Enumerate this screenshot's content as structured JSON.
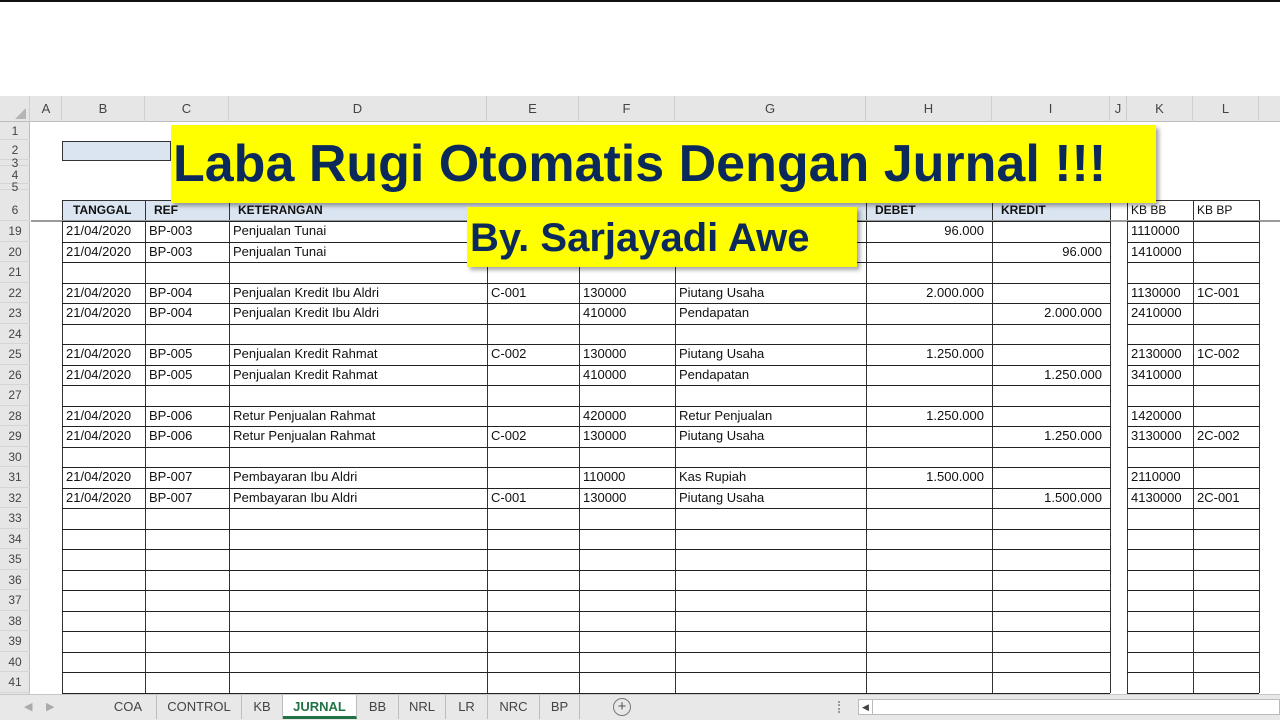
{
  "banner": {
    "title": "Laba Rugi Otomatis Dengan Jurnal !!!",
    "subtitle": "By. Sarjayadi Awe",
    "bg_color": "#ffff00",
    "text_color": "#0b2a5b"
  },
  "columns": [
    "A",
    "B",
    "C",
    "D",
    "E",
    "F",
    "G",
    "H",
    "I",
    "J",
    "K",
    "L"
  ],
  "row_numbers": [
    "1",
    "2",
    "3",
    "4",
    "5",
    "6",
    "19",
    "20",
    "21",
    "22",
    "23",
    "24",
    "25",
    "26",
    "27",
    "28",
    "29",
    "30",
    "31",
    "32",
    "33",
    "34",
    "35",
    "36",
    "37",
    "38",
    "39",
    "40",
    "41"
  ],
  "table_headers": {
    "tanggal": "TANGGAL",
    "ref": "REF",
    "keterangan": "KETERANGAN",
    "debet": "DEBET",
    "kredit": "KREDIT",
    "kb_bb": "KB BB",
    "kb_bp": "KB BP"
  },
  "rows": [
    {
      "row": "19",
      "tanggal": "21/04/2020",
      "ref": "BP-003",
      "keterangan": "Penjualan Tunai",
      "kode": "",
      "akun": "",
      "nama_akun": "",
      "debet": "96.000",
      "kredit": "",
      "kb_bb": "1110000",
      "kb_bp": ""
    },
    {
      "row": "20",
      "tanggal": "21/04/2020",
      "ref": "BP-003",
      "keterangan": "Penjualan Tunai",
      "kode": "",
      "akun": "",
      "nama_akun": "",
      "debet": "",
      "kredit": "96.000",
      "kb_bb": "1410000",
      "kb_bp": ""
    },
    {
      "row": "21",
      "tanggal": "",
      "ref": "",
      "keterangan": "",
      "kode": "",
      "akun": "",
      "nama_akun": "",
      "debet": "",
      "kredit": "",
      "kb_bb": "",
      "kb_bp": ""
    },
    {
      "row": "22",
      "tanggal": "21/04/2020",
      "ref": "BP-004",
      "keterangan": "Penjualan Kredit Ibu Aldri",
      "kode": "C-001",
      "akun": "130000",
      "nama_akun": "Piutang Usaha",
      "debet": "2.000.000",
      "kredit": "",
      "kb_bb": "1130000",
      "kb_bp": "1C-001"
    },
    {
      "row": "23",
      "tanggal": "21/04/2020",
      "ref": "BP-004",
      "keterangan": "Penjualan Kredit Ibu Aldri",
      "kode": "",
      "akun": "410000",
      "nama_akun": "Pendapatan",
      "debet": "",
      "kredit": "2.000.000",
      "kb_bb": "2410000",
      "kb_bp": ""
    },
    {
      "row": "24",
      "tanggal": "",
      "ref": "",
      "keterangan": "",
      "kode": "",
      "akun": "",
      "nama_akun": "",
      "debet": "",
      "kredit": "",
      "kb_bb": "",
      "kb_bp": ""
    },
    {
      "row": "25",
      "tanggal": "21/04/2020",
      "ref": "BP-005",
      "keterangan": "Penjualan Kredit Rahmat",
      "kode": "C-002",
      "akun": "130000",
      "nama_akun": "Piutang Usaha",
      "debet": "1.250.000",
      "kredit": "",
      "kb_bb": "2130000",
      "kb_bp": "1C-002"
    },
    {
      "row": "26",
      "tanggal": "21/04/2020",
      "ref": "BP-005",
      "keterangan": "Penjualan Kredit Rahmat",
      "kode": "",
      "akun": "410000",
      "nama_akun": "Pendapatan",
      "debet": "",
      "kredit": "1.250.000",
      "kb_bb": "3410000",
      "kb_bp": ""
    },
    {
      "row": "27",
      "tanggal": "",
      "ref": "",
      "keterangan": "",
      "kode": "",
      "akun": "",
      "nama_akun": "",
      "debet": "",
      "kredit": "",
      "kb_bb": "",
      "kb_bp": ""
    },
    {
      "row": "28",
      "tanggal": "21/04/2020",
      "ref": "BP-006",
      "keterangan": "Retur Penjualan Rahmat",
      "kode": "",
      "akun": "420000",
      "nama_akun": "Retur Penjualan",
      "debet": "1.250.000",
      "kredit": "",
      "kb_bb": "1420000",
      "kb_bp": ""
    },
    {
      "row": "29",
      "tanggal": "21/04/2020",
      "ref": "BP-006",
      "keterangan": "Retur Penjualan Rahmat",
      "kode": "C-002",
      "akun": "130000",
      "nama_akun": "Piutang Usaha",
      "debet": "",
      "kredit": "1.250.000",
      "kb_bb": "3130000",
      "kb_bp": "2C-002"
    },
    {
      "row": "30",
      "tanggal": "",
      "ref": "",
      "keterangan": "",
      "kode": "",
      "akun": "",
      "nama_akun": "",
      "debet": "",
      "kredit": "",
      "kb_bb": "",
      "kb_bp": ""
    },
    {
      "row": "31",
      "tanggal": "21/04/2020",
      "ref": "BP-007",
      "keterangan": "Pembayaran Ibu Aldri",
      "kode": "",
      "akun": "110000",
      "nama_akun": "Kas Rupiah",
      "debet": "1.500.000",
      "kredit": "",
      "kb_bb": "2110000",
      "kb_bp": ""
    },
    {
      "row": "32",
      "tanggal": "21/04/2020",
      "ref": "BP-007",
      "keterangan": "Pembayaran Ibu Aldri",
      "kode": "C-001",
      "akun": "130000",
      "nama_akun": "Piutang Usaha",
      "debet": "",
      "kredit": "1.500.000",
      "kb_bb": "4130000",
      "kb_bp": "2C-001"
    },
    {
      "row": "33"
    },
    {
      "row": "34"
    },
    {
      "row": "35"
    },
    {
      "row": "36"
    },
    {
      "row": "37"
    },
    {
      "row": "38"
    },
    {
      "row": "39"
    },
    {
      "row": "40"
    },
    {
      "row": "41"
    }
  ],
  "sheet_tabs": [
    {
      "label": "COA",
      "active": false
    },
    {
      "label": "CONTROL",
      "active": false
    },
    {
      "label": "KB",
      "active": false
    },
    {
      "label": "JURNAL",
      "active": true
    },
    {
      "label": "BB",
      "active": false
    },
    {
      "label": "NRL",
      "active": false
    },
    {
      "label": "LR",
      "active": false
    },
    {
      "label": "NRC",
      "active": false
    },
    {
      "label": "BP",
      "active": false
    }
  ],
  "add_sheet_icon": "plus-circle-icon",
  "accent_color": "#217346"
}
